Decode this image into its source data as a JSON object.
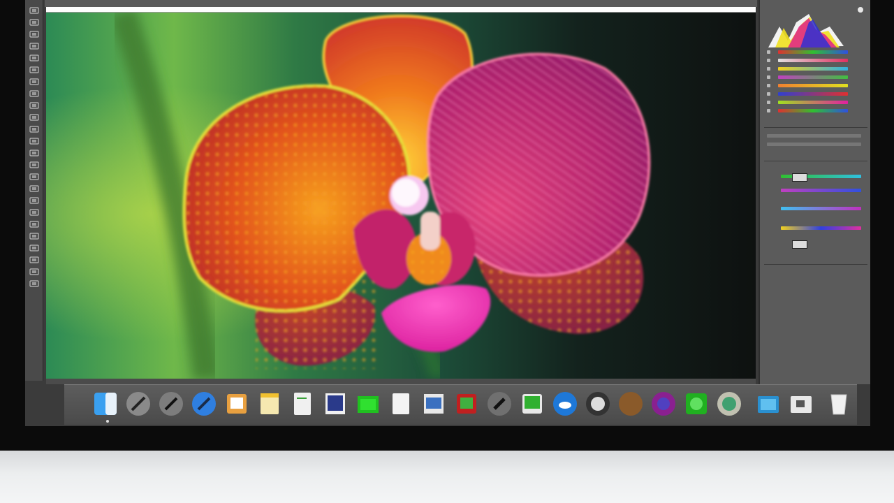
{
  "document": {
    "progress": 1.0
  },
  "colors": {
    "canvas_bg": "#0f1412",
    "panel_bg": "#5b5b5b",
    "dock_bg": "#4a4a4a",
    "orchid_petal_orange": "#e0621c",
    "orchid_petal_magenta": "#b0246e",
    "orchid_lip": "#f02fb0",
    "stem_green": "#2f8a3f"
  },
  "toolbar": {
    "tools": [
      "move-tool",
      "marquee-tool",
      "lasso-tool",
      "magic-wand-tool",
      "crop-tool",
      "eyedropper-tool",
      "healing-tool",
      "brush-tool",
      "clone-stamp-tool",
      "history-brush-tool",
      "eraser-tool",
      "gradient-tool",
      "blur-tool",
      "dodge-tool",
      "pen-tool",
      "type-tool",
      "path-select-tool",
      "shape-tool",
      "hand-tool",
      "zoom-tool",
      "foreground-color",
      "background-color",
      "quick-mask",
      "screen-mode"
    ]
  },
  "panels": {
    "histogram": {
      "icon": "histogram-icon"
    },
    "adjustments": {
      "icon": "adjustments-icon"
    },
    "layers": {
      "icon": "layers-icon"
    }
  },
  "dock": {
    "items": [
      {
        "name": "finder",
        "icon": "finder-icon"
      },
      {
        "name": "launchpad",
        "icon": "rocket-icon"
      },
      {
        "name": "app-pen",
        "icon": "pen-icon"
      },
      {
        "name": "safari",
        "icon": "compass-icon"
      },
      {
        "name": "contacts",
        "icon": "contacts-icon"
      },
      {
        "name": "notes",
        "icon": "notes-icon"
      },
      {
        "name": "text-edit",
        "icon": "document-icon"
      },
      {
        "name": "preview",
        "icon": "photo-icon"
      },
      {
        "name": "numbers",
        "icon": "spreadsheet-icon"
      },
      {
        "name": "pages",
        "icon": "page-icon"
      },
      {
        "name": "image-capture",
        "icon": "image-capture-icon"
      },
      {
        "name": "photo-booth",
        "icon": "photo-booth-icon"
      },
      {
        "name": "screenshot",
        "icon": "camera-icon"
      },
      {
        "name": "maps",
        "icon": "map-icon"
      },
      {
        "name": "icloud",
        "icon": "cloud-icon"
      },
      {
        "name": "video-app",
        "icon": "film-icon"
      },
      {
        "name": "wood-app",
        "icon": "folder-wood-icon"
      },
      {
        "name": "music",
        "icon": "music-icon"
      },
      {
        "name": "messages",
        "icon": "chat-icon"
      },
      {
        "name": "photos",
        "icon": "photos-icon"
      },
      {
        "name": "app-store",
        "icon": "app-store-icon"
      },
      {
        "name": "downloads",
        "icon": "downloads-folder-icon"
      },
      {
        "name": "trash",
        "icon": "trash-icon"
      }
    ]
  }
}
